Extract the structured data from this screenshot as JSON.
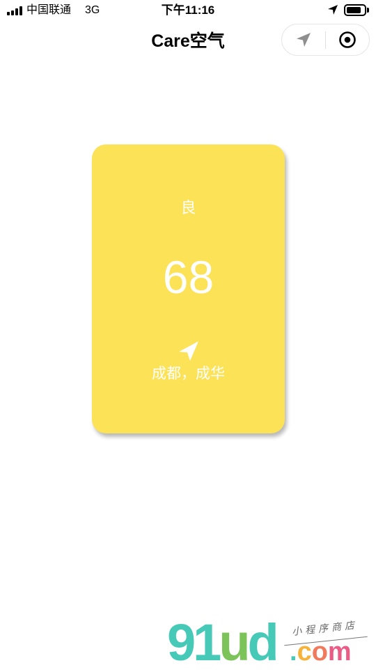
{
  "status_bar": {
    "carrier": "中国联通",
    "network": "3G",
    "time": "下午11:16",
    "battery_level": 0.85
  },
  "nav": {
    "title": "Care空气"
  },
  "card": {
    "level": "良",
    "aqi": "68",
    "location": "成都，成华",
    "color": "#fbe256",
    "location_icon": "navigation-arrow-icon"
  },
  "capsule": {
    "left_icon": "location-arrow-icon",
    "right_icon": "target-icon"
  },
  "watermark": {
    "logo": "91ud",
    "domain": ".com",
    "tagline": "小程序商店"
  }
}
